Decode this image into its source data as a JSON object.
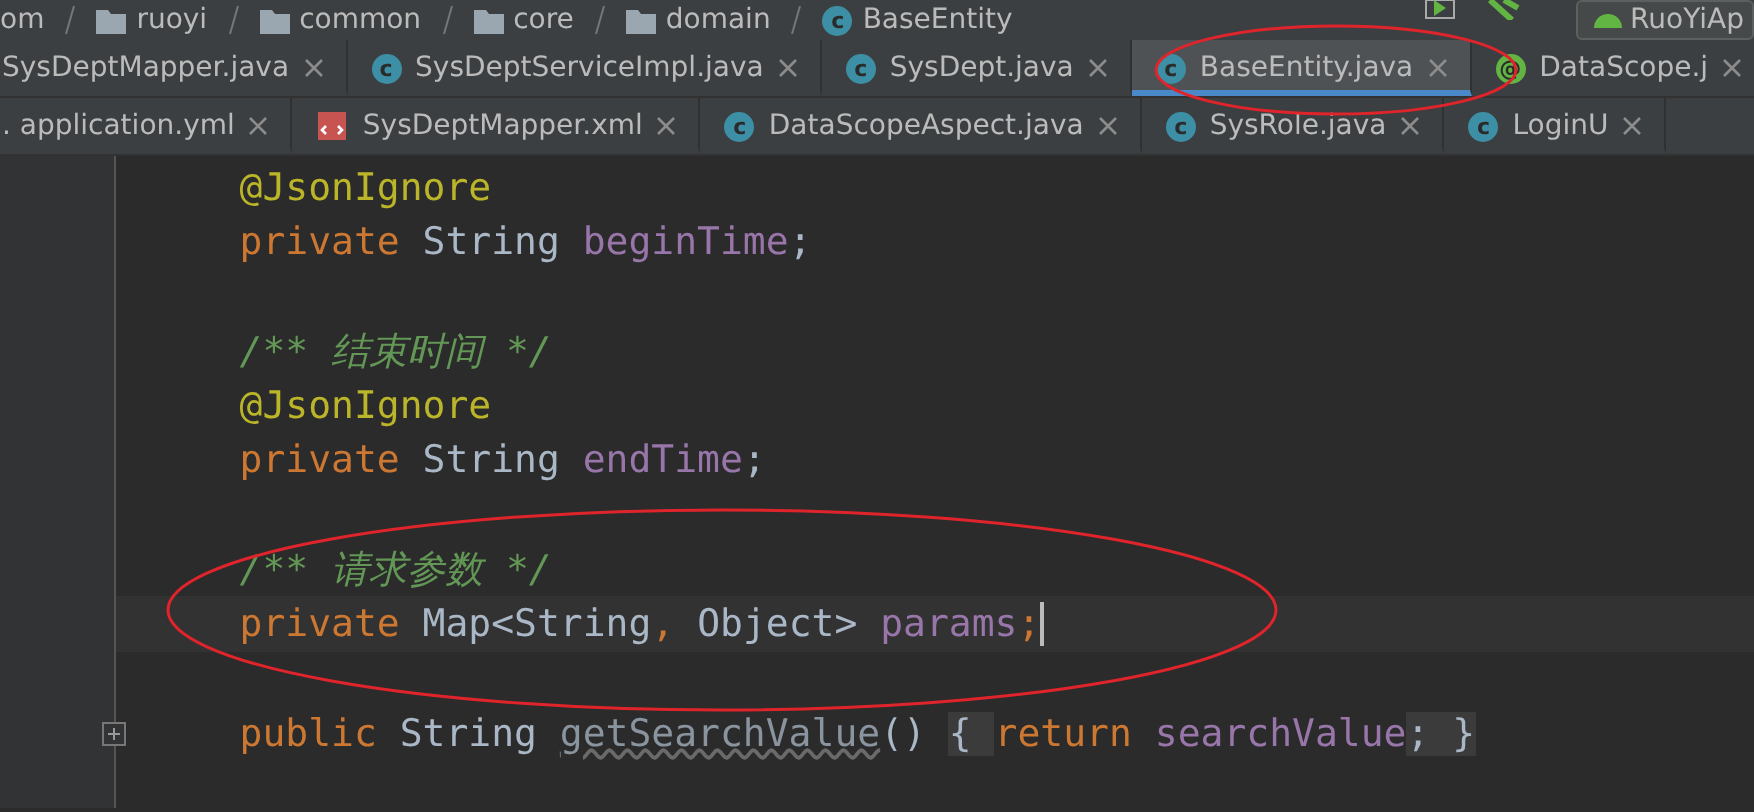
{
  "breadcrumb": {
    "items": [
      {
        "label": "om",
        "kind": "plain"
      },
      {
        "label": "ruoyi",
        "kind": "folder"
      },
      {
        "label": "common",
        "kind": "folder"
      },
      {
        "label": "core",
        "kind": "folder"
      },
      {
        "label": "domain",
        "kind": "folder"
      },
      {
        "label": "BaseEntity",
        "kind": "class",
        "badge": "c"
      }
    ],
    "run_config": "RuoYiAp"
  },
  "tab_rows": [
    [
      {
        "label": "SysDeptMapper.java",
        "kind": "plain",
        "selected": false
      },
      {
        "label": "SysDeptServiceImpl.java",
        "kind": "class",
        "badge": "c",
        "selected": false
      },
      {
        "label": "SysDept.java",
        "kind": "class",
        "badge": "c",
        "selected": false
      },
      {
        "label": "BaseEntity.java",
        "kind": "class",
        "badge": "c",
        "selected": true
      },
      {
        "label": "DataScope.j",
        "kind": "annotation",
        "badge": "@",
        "selected": false
      }
    ],
    [
      {
        "label": ". application.yml",
        "kind": "plain",
        "selected": false
      },
      {
        "label": "SysDeptMapper.xml",
        "kind": "xml",
        "selected": false
      },
      {
        "label": "DataScopeAspect.java",
        "kind": "class",
        "badge": "c",
        "selected": false
      },
      {
        "label": "SysRole.java",
        "kind": "class",
        "badge": "c",
        "selected": false
      },
      {
        "label": "LoginU",
        "kind": "class",
        "badge": "c",
        "selected": false
      }
    ]
  ],
  "code_lines": [
    {
      "kind": "code",
      "current": false,
      "tokens": [
        {
          "kind": "annotation",
          "t": "@JsonIgnore"
        }
      ]
    },
    {
      "kind": "code",
      "current": false,
      "tokens": [
        {
          "kind": "keyword",
          "t": "private"
        },
        {
          "kind": "plain",
          "t": " String "
        },
        {
          "kind": "field",
          "t": "beginTime"
        },
        {
          "kind": "plain",
          "t": ";"
        }
      ]
    },
    {
      "kind": "blank"
    },
    {
      "kind": "code",
      "current": false,
      "tokens": [
        {
          "kind": "comment",
          "t": "/** 结束时间 */"
        }
      ]
    },
    {
      "kind": "code",
      "current": false,
      "tokens": [
        {
          "kind": "annotation",
          "t": "@JsonIgnore"
        }
      ]
    },
    {
      "kind": "code",
      "current": false,
      "tokens": [
        {
          "kind": "keyword",
          "t": "private"
        },
        {
          "kind": "plain",
          "t": " String "
        },
        {
          "kind": "field",
          "t": "endTime"
        },
        {
          "kind": "plain",
          "t": ";"
        }
      ]
    },
    {
      "kind": "blank"
    },
    {
      "kind": "code",
      "current": false,
      "tokens": [
        {
          "kind": "comment",
          "t": "/** 请求参数 */"
        }
      ]
    },
    {
      "kind": "code",
      "current": true,
      "tokens": [
        {
          "kind": "keyword",
          "t": "private"
        },
        {
          "kind": "plain",
          "t": " Map<String"
        },
        {
          "kind": "keyword",
          "t": ","
        },
        {
          "kind": "plain",
          "t": " Object> "
        },
        {
          "kind": "field",
          "t": "params"
        },
        {
          "kind": "keyword",
          "t": ";"
        }
      ]
    },
    {
      "kind": "blank"
    },
    {
      "kind": "code",
      "current": false,
      "fold": true,
      "tokens": [
        {
          "kind": "keyword",
          "t": "public"
        },
        {
          "kind": "plain",
          "t": " String "
        },
        {
          "kind": "unused",
          "t": "getSearchValue"
        },
        {
          "kind": "plain",
          "t": "() "
        },
        {
          "kind": "brace",
          "t": "{ "
        },
        {
          "kind": "keyword",
          "t": "return"
        },
        {
          "kind": "field",
          "t": " searchValue"
        },
        {
          "kind": "brace",
          "t": "; }"
        }
      ]
    }
  ]
}
